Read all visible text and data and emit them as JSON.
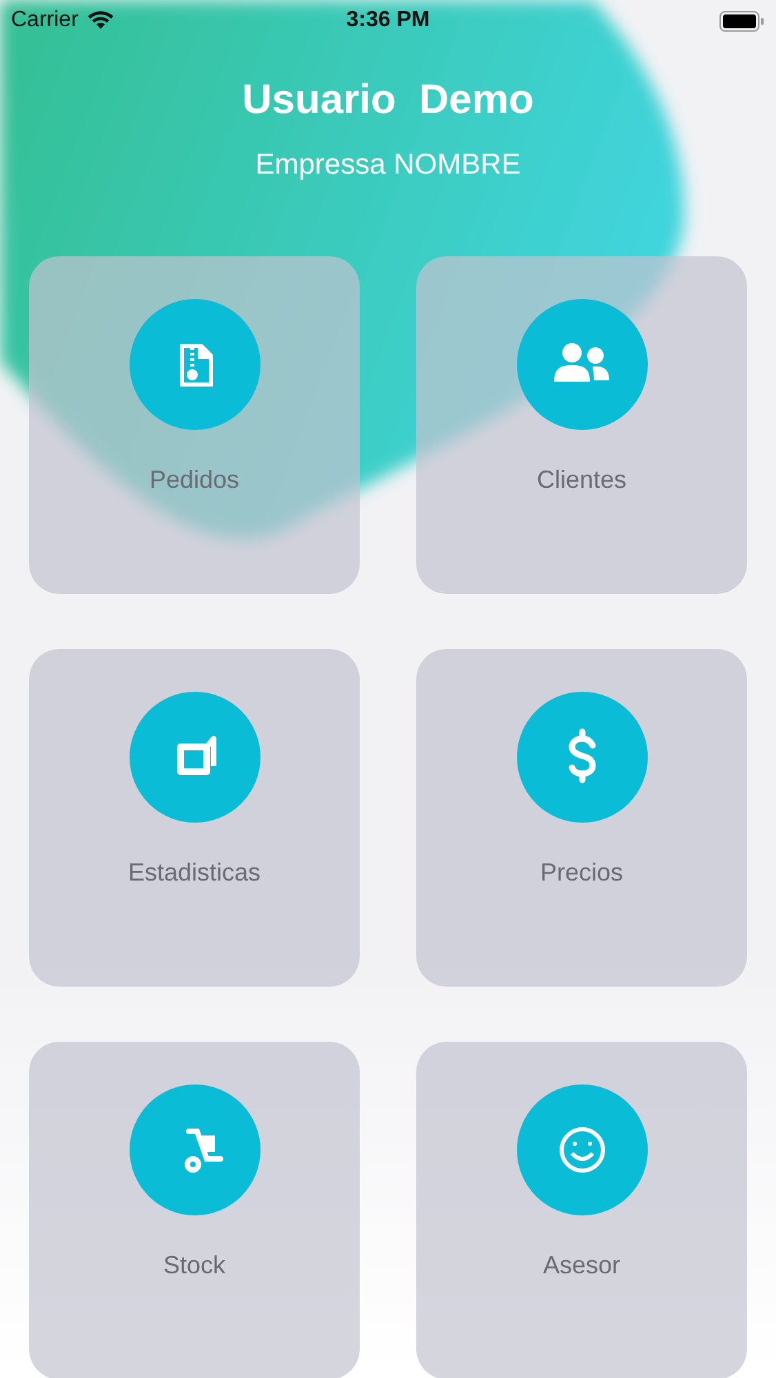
{
  "status_bar": {
    "carrier": "Carrier",
    "time": "3:36 PM"
  },
  "header": {
    "user": "Usuario  Demo",
    "company": "Empressa NOMBRE"
  },
  "menu": [
    {
      "label": "Pedidos",
      "kind": "orders"
    },
    {
      "label": "Clientes",
      "kind": "clients"
    },
    {
      "label": "Estadisticas",
      "kind": "stats"
    },
    {
      "label": "Precios",
      "kind": "prices"
    },
    {
      "label": "Stock",
      "kind": "stock"
    },
    {
      "label": "Asesor",
      "kind": "advisor"
    }
  ]
}
